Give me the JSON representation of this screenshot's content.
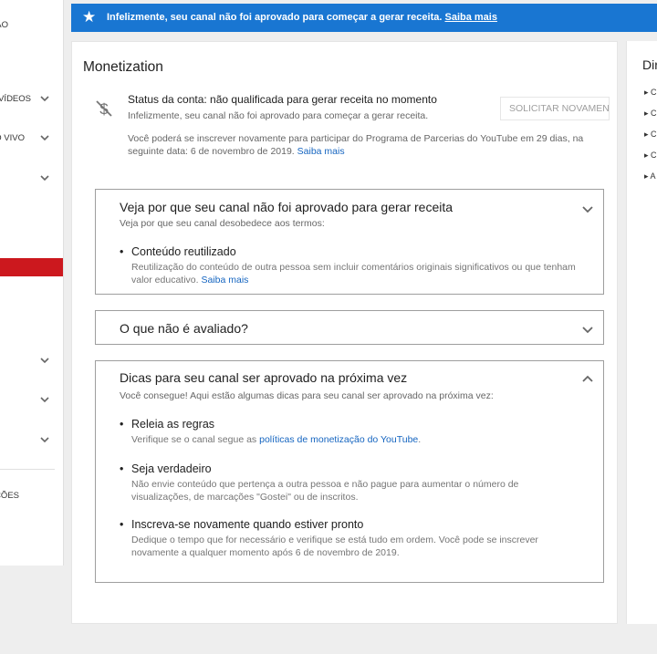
{
  "sidebar": {
    "items": [
      {
        "label": "ÃO",
        "has_chevron": false
      },
      {
        "label": "VÍDEOS",
        "has_chevron": true
      },
      {
        "label": "O VIVO",
        "has_chevron": true
      },
      {
        "label": "",
        "has_chevron": true
      },
      {
        "label": "",
        "has_chevron": true
      },
      {
        "label": "",
        "has_chevron": true
      },
      {
        "label": "",
        "has_chevron": true
      },
      {
        "label": "ÇÕES",
        "has_chevron": false
      }
    ],
    "active_color": "#cc181e"
  },
  "banner": {
    "icon": "star-icon",
    "text": "Infelizmente, seu canal não foi aprovado para começar a gerar receita.",
    "link": "Saiba mais",
    "bg_color": "#1976d2"
  },
  "main": {
    "title": "Monetization",
    "status_icon": "dollar-off-icon",
    "status_line": "Status da conta: não qualificada para gerar receita no momento",
    "status_sub": "Infelizmente, seu canal não foi aprovado para começar a gerar receita.",
    "request_button": "SOLICITAR NOVAMENTE",
    "reapply_text": "Você poderá se inscrever novamente para participar do Programa de Parcerias do YouTube em 29 dias, na seguinte data: 6 de novembro de 2019.",
    "reapply_link": "Saiba mais",
    "cards": {
      "why": {
        "title": "Veja por que seu canal não foi aprovado para gerar receita",
        "intro": "Veja por que seu canal desobedece aos termos:",
        "bullet_title": "Conteúdo reutilizado",
        "bullet_desc": "Reutilização do conteúdo de outra pessoa sem incluir comentários originais significativos ou que tenham valor educativo.",
        "bullet_link": "Saiba mais"
      },
      "not_reviewed": {
        "title": "O que não é avaliado?"
      },
      "tips": {
        "title": "Dicas para seu canal ser aprovado na próxima vez",
        "intro": "Você consegue! Aqui estão algumas dicas para seu canal ser aprovado na próxima vez:",
        "b1_title": "Releia as regras",
        "b1_pre": "Verifique se o canal segue as",
        "b1_link": "políticas de monetização do YouTube",
        "b1_post": ".",
        "b2_title": "Seja verdadeiro",
        "b2_desc": "Não envie conteúdo que pertença a outra pessoa e não pague para aumentar o número de visualizações, de marcações \"Gostei\" ou de inscritos.",
        "b3_title": "Inscreva-se novamente quando estiver pronto",
        "b3_desc": "Dedique o tempo que for necessário e verifique se está tudo em ordem. Você pode se inscrever novamente a qualquer momento após 6 de novembro de 2019."
      }
    }
  },
  "right_panel": {
    "title": "Dir",
    "items": [
      "C",
      "C",
      "C",
      "C",
      "A"
    ]
  }
}
